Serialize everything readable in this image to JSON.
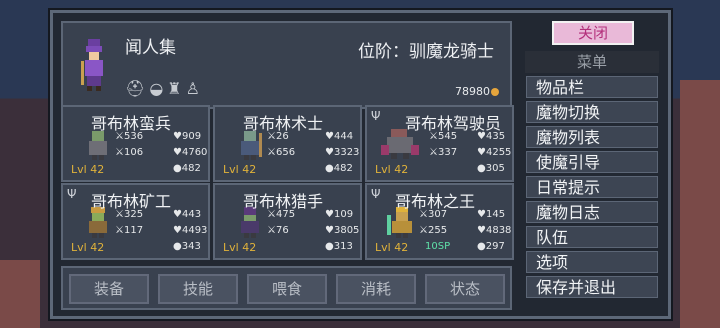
{
  "hero": {
    "name": "闻人集",
    "rank": "位阶：驯魔龙骑士",
    "gold": "78980"
  },
  "cards": [
    {
      "name": "哥布林蛮兵",
      "attack": "536",
      "defense": "106",
      "hp": "909",
      "hp2": "4760",
      "speed": "482",
      "level": "Lvl 42",
      "sp": ""
    },
    {
      "name": "哥布林术士",
      "attack": "26",
      "defense": "656",
      "hp": "444",
      "hp2": "3323",
      "speed": "482",
      "level": "Lvl 42",
      "sp": ""
    },
    {
      "name": "哥布林驾驶员",
      "attack": "545",
      "defense": "337",
      "hp": "435",
      "hp2": "4255",
      "speed": "305",
      "level": "Lvl 42",
      "sp": ""
    },
    {
      "name": "哥布林矿工",
      "attack": "325",
      "defense": "117",
      "hp": "443",
      "hp2": "4493",
      "speed": "343",
      "level": "Lvl 42",
      "sp": ""
    },
    {
      "name": "哥布林猎手",
      "attack": "475",
      "defense": "76",
      "hp": "109",
      "hp2": "3805",
      "speed": "313",
      "level": "Lvl 42",
      "sp": ""
    },
    {
      "name": "哥布林之王",
      "attack": "307",
      "defense": "255",
      "hp": "145",
      "hp2": "4838",
      "speed": "297",
      "level": "Lvl 42",
      "sp": "10SP"
    }
  ],
  "tabs": [
    "装备",
    "技能",
    "喂食",
    "消耗",
    "状态"
  ],
  "menu": {
    "close": "关闭",
    "title": "菜单",
    "items": [
      "物品栏",
      "魔物切换",
      "魔物列表",
      "使魔引导",
      "日常提示",
      "魔物日志",
      "队伍",
      "选项",
      "保存并退出"
    ]
  },
  "colors": {
    "level": "#e0b23a",
    "sp": "#5fe0a8",
    "close_bg": "#e9b9d8",
    "close_text": "#b3307b"
  }
}
